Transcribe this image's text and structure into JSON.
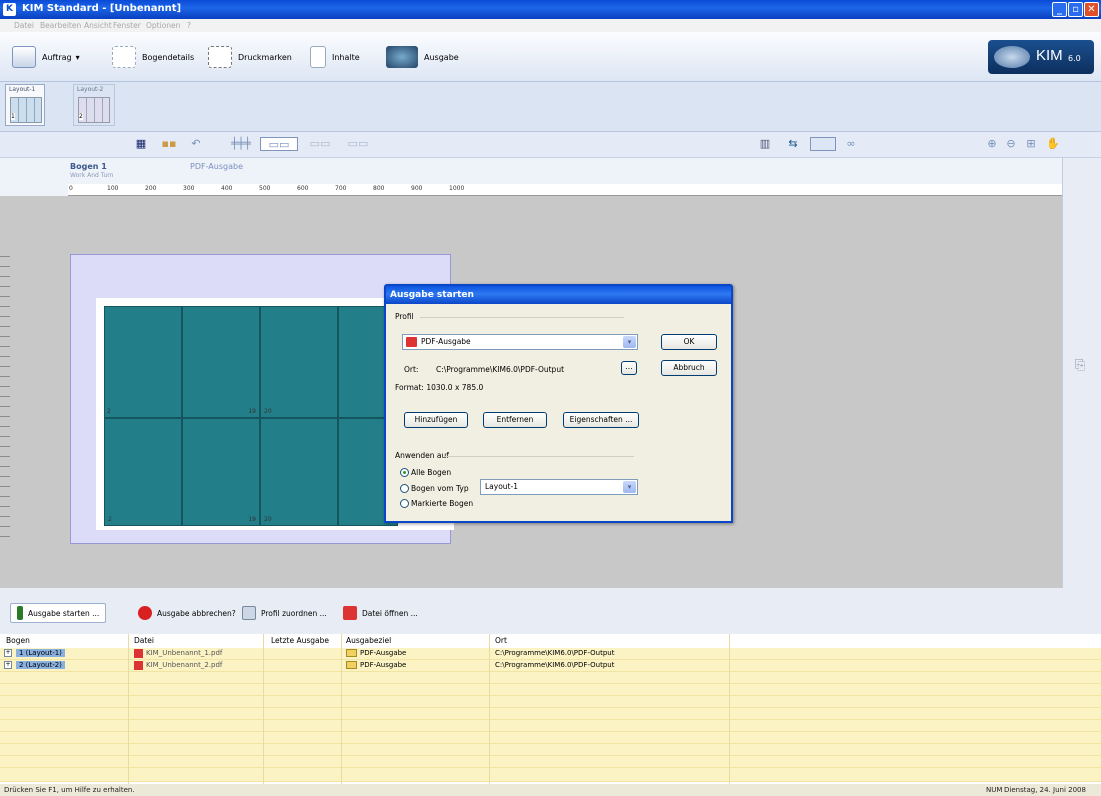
{
  "window": {
    "title": "KIM Standard - [Unbenannt]"
  },
  "menu": [
    "Datei",
    "Bearbeiten",
    "Ansicht",
    "Fenster",
    "Optionen",
    "?"
  ],
  "toolbar": {
    "items": [
      "Auftrag",
      "Bogendetails",
      "Druckmarken",
      "Inhalte",
      "Ausgabe"
    ],
    "logo_text": "KIM",
    "logo_version": "6.0"
  },
  "layouts": {
    "tabs": [
      "Layout-1",
      "Layout-2"
    ],
    "numbers": [
      "1",
      "2"
    ]
  },
  "sheet": {
    "title": "Bogen 1",
    "subtitle": "Work And Turn",
    "output": "PDF-Ausgabe"
  },
  "ruler": [
    "0",
    "100",
    "200",
    "300",
    "400",
    "500",
    "600",
    "700",
    "800",
    "900",
    "1000"
  ],
  "tiles": {
    "labels": [
      "2",
      "19",
      "20",
      "2",
      "19",
      "20"
    ]
  },
  "dialog": {
    "title": "Ausgabe starten",
    "profile_group": "Profil",
    "profile_value": "PDF-Ausgabe",
    "ok": "OK",
    "cancel": "Abbruch",
    "ort_label": "Ort:",
    "ort_value": "C:\\Programme\\KIM6.0\\PDF-Output",
    "browse": "...",
    "format": "Format: 1030.0 x 785.0",
    "add": "Hinzufügen",
    "remove": "Entfernen",
    "properties": "Eigenschaften ...",
    "apply_group": "Anwenden auf",
    "radio_all": "Alle Bogen",
    "radio_type": "Bogen vom Typ",
    "type_value": "Layout-1",
    "radio_marked": "Markierte Bogen"
  },
  "actions": [
    "Ausgabe starten ...",
    "Ausgabe abbrechen?",
    "Profil zuordnen ...",
    "Datei öffnen ..."
  ],
  "table": {
    "headers": [
      "Bogen",
      "Datei",
      "Letzte Ausgabe",
      "Ausgabeziel",
      "Ort"
    ],
    "rows": [
      {
        "bogen": "1 (Layout-1)",
        "datei": "KIM_Unbenannt_1.pdf",
        "letzte": "",
        "ziel": "PDF-Ausgabe",
        "ort": "C:\\Programme\\KIM6.0\\PDF-Output"
      },
      {
        "bogen": "2 (Layout-2)",
        "datei": "KIM_Unbenannt_2.pdf",
        "letzte": "",
        "ziel": "PDF-Ausgabe",
        "ort": "C:\\Programme\\KIM6.0\\PDF-Output"
      }
    ]
  },
  "status": {
    "left": "Drücken Sie F1, um Hilfe zu erhalten.",
    "num": "NUM",
    "date": "Dienstag, 24. Juni 2008"
  },
  "colors": {
    "accent": "#0a4ad6",
    "tile": "#227f8a",
    "row": "#fbf3c4"
  }
}
